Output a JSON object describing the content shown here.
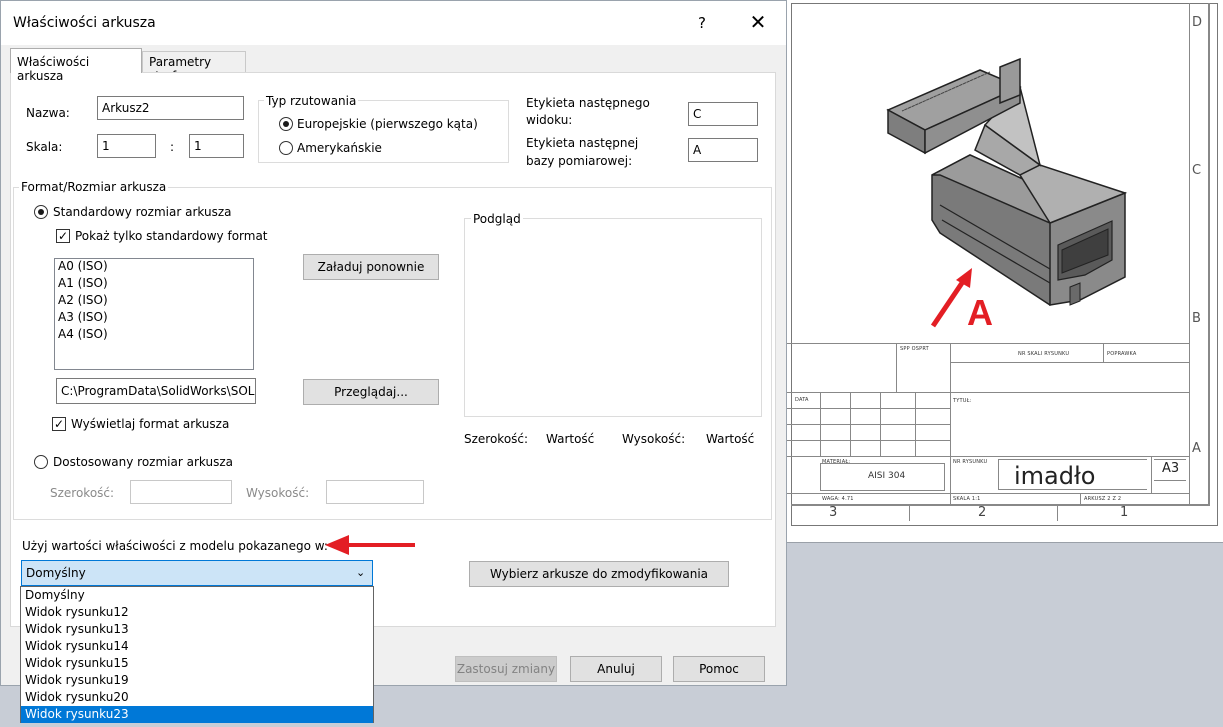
{
  "dialog": {
    "title": "Właściwości arkusza",
    "help": "?",
    "close": "✕"
  },
  "tabs": [
    {
      "label": "Właściwości arkusza",
      "active": true
    },
    {
      "label": "Parametry strefy",
      "active": false
    }
  ],
  "fields": {
    "name_label": "Nazwa:",
    "name_value": "Arkusz2",
    "scale_label": "Skala:",
    "scale_a": "1",
    "scale_sep": ":",
    "scale_b": "1"
  },
  "projection": {
    "caption": "Typ rzutowania",
    "european": "Europejskie (pierwszego kąta)",
    "american": "Amerykańskie",
    "selected": "european"
  },
  "labels": {
    "next_view_label_1": "Etykieta następnego",
    "next_view_label_2": "widoku:",
    "next_view_value": "C",
    "next_datum_label_1": "Etykieta następnej",
    "next_datum_label_2": "bazy pomiarowej:",
    "next_datum_value": "A"
  },
  "format": {
    "caption": "Format/Rozmiar arkusza",
    "standard_radio": "Standardowy rozmiar arkusza",
    "only_standard_check": "Pokaż tylko standardowy format",
    "sizes": [
      "A0 (ISO)",
      "A1 (ISO)",
      "A2 (ISO)",
      "A3 (ISO)",
      "A4 (ISO)"
    ],
    "reload_button": "Załaduj ponownie",
    "path_value": "C:\\ProgramData\\SolidWorks\\SOL",
    "browse_button": "Przeglądaj...",
    "display_format_check": "Wyświetlaj format arkusza",
    "custom_radio": "Dostosowany rozmiar arkusza",
    "width_label": "Szerokość:",
    "height_label": "Wysokość:"
  },
  "preview": {
    "caption": "Podgląd",
    "width_label": "Szerokość:",
    "width_value": "Wartość",
    "height_label": "Wysokość:",
    "height_value": "Wartość"
  },
  "model_props": {
    "label": "Użyj wartości właściwości z modelu pokazanego w:",
    "selected": "Domyślny",
    "options": [
      "Domyślny",
      "Widok rysunku12",
      "Widok rysunku13",
      "Widok rysunku14",
      "Widok rysunku15",
      "Widok rysunku19",
      "Widok rysunku20",
      "Widok rysunku23"
    ],
    "highlighted_index": 7,
    "select_sheets_button": "Wybierz arkusze do zmodyfikowania"
  },
  "footer": {
    "apply_button": "Zastosuj zmiany",
    "cancel_button": "Anuluj",
    "help_button": "Pomoc"
  },
  "drawing": {
    "zone_letters": [
      "D",
      "C",
      "B",
      "A"
    ],
    "zone_numbers": [
      "3",
      "2",
      "1"
    ],
    "callout_letter": "A",
    "logo": "imadło",
    "sheet_size": "A3",
    "material": "AISI 304",
    "title_small": [
      "SPP OSPRT",
      "NR SKALI RYSUNKU",
      "POPRAWKA",
      "DATA",
      "TYTUŁ:",
      "MATERIAŁ:",
      "NR RYSUNKU",
      "WAGA: 4.71",
      "SKALA 1:1",
      "ARKUSZ 2 Z 2"
    ]
  },
  "colors": {
    "accent": "#0078d7",
    "highlight_red": "#e31e24"
  }
}
